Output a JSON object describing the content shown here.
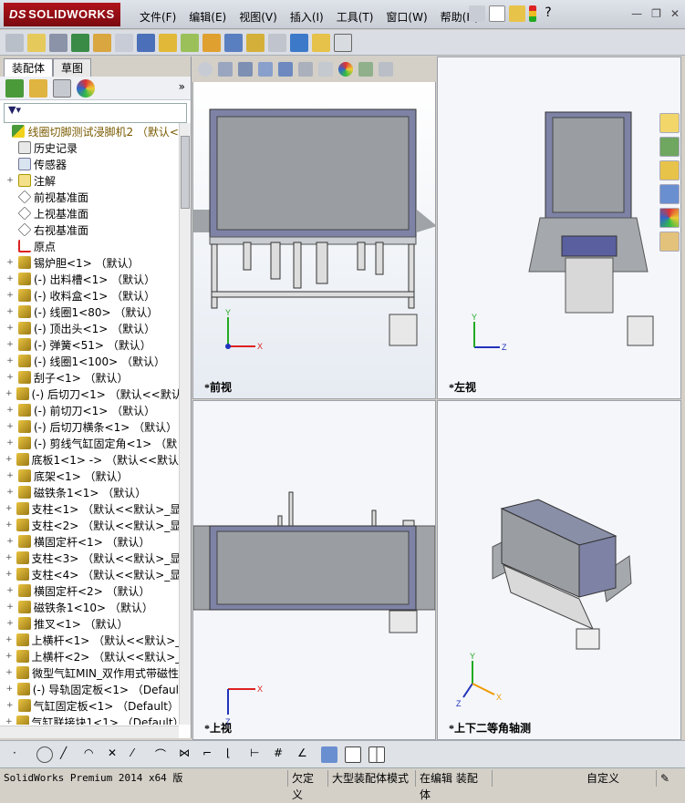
{
  "app": {
    "brand": "SOLIDWORKS",
    "brand_prefix": "DS"
  },
  "menu": [
    "文件(F)",
    "编辑(E)",
    "视图(V)",
    "插入(I)",
    "工具(T)",
    "窗口(W)",
    "帮助(H)"
  ],
  "left_panel": {
    "tabs": [
      "装配体",
      "草图"
    ],
    "tree": [
      {
        "label": "线圈切脚测试浸脚机2 （默认<",
        "icon": "warning",
        "exp": ""
      },
      {
        "label": "历史记录",
        "icon": "history",
        "exp": ""
      },
      {
        "label": "传感器",
        "icon": "sensor",
        "exp": ""
      },
      {
        "label": "注解",
        "icon": "annotation",
        "exp": "+"
      },
      {
        "label": "前视基准面",
        "icon": "plane",
        "exp": ""
      },
      {
        "label": "上视基准面",
        "icon": "plane",
        "exp": ""
      },
      {
        "label": "右视基准面",
        "icon": "plane",
        "exp": ""
      },
      {
        "label": "原点",
        "icon": "origin",
        "exp": ""
      },
      {
        "label": "锡炉胆<1> （默认）",
        "icon": "part",
        "exp": "+"
      },
      {
        "label": "(-) 出料槽<1> （默认）",
        "icon": "part",
        "exp": "+"
      },
      {
        "label": "(-) 收料盒<1> （默认）",
        "icon": "part",
        "exp": "+"
      },
      {
        "label": "(-) 线圈1<80> （默认）",
        "icon": "part",
        "exp": "+"
      },
      {
        "label": "(-) 顶出头<1> （默认）",
        "icon": "part",
        "exp": "+"
      },
      {
        "label": "(-) 弹簧<51> （默认）",
        "icon": "part",
        "exp": "+"
      },
      {
        "label": "(-) 线圈1<100> （默认）",
        "icon": "part",
        "exp": "+"
      },
      {
        "label": "刮子<1> （默认）",
        "icon": "part",
        "exp": "+"
      },
      {
        "label": "(-) 后切刀<1> （默认<<默认",
        "icon": "part",
        "exp": "+"
      },
      {
        "label": "(-) 前切刀<1> （默认）",
        "icon": "part",
        "exp": "+"
      },
      {
        "label": "(-) 后切刀横条<1> （默认）",
        "icon": "part",
        "exp": "+"
      },
      {
        "label": "(-) 剪线气缸固定角<1> （默",
        "icon": "part",
        "exp": "+"
      },
      {
        "label": "底板1<1> -> （默认<<默认>_",
        "icon": "part",
        "exp": "+"
      },
      {
        "label": "底架<1> （默认）",
        "icon": "part",
        "exp": "+"
      },
      {
        "label": "磁铁条1<1> （默认）",
        "icon": "part",
        "exp": "+"
      },
      {
        "label": "支柱<1> （默认<<默认>_显示",
        "icon": "part",
        "exp": "+"
      },
      {
        "label": "支柱<2> （默认<<默认>_显示",
        "icon": "part",
        "exp": "+"
      },
      {
        "label": "横固定杆<1> （默认）",
        "icon": "part",
        "exp": "+"
      },
      {
        "label": "支柱<3> （默认<<默认>_显示",
        "icon": "part",
        "exp": "+"
      },
      {
        "label": "支柱<4> （默认<<默认>_显示",
        "icon": "part",
        "exp": "+"
      },
      {
        "label": "横固定杆<2> （默认）",
        "icon": "part",
        "exp": "+"
      },
      {
        "label": "磁铁条1<10> （默认）",
        "icon": "part",
        "exp": "+"
      },
      {
        "label": "推叉<1> （默认）",
        "icon": "part",
        "exp": "+"
      },
      {
        "label": "上横杆<1> （默认<<默认>_显",
        "icon": "part",
        "exp": "+"
      },
      {
        "label": "上横杆<2> （默认<<默认>_显",
        "icon": "part",
        "exp": "+"
      },
      {
        "label": "微型气缸MIN_双作用式带磁性",
        "icon": "part",
        "exp": "+"
      },
      {
        "label": "(-) 导轨固定板<1> （Defaul",
        "icon": "part",
        "exp": "+"
      },
      {
        "label": "气缸固定板<1> （Default）",
        "icon": "part",
        "exp": "+"
      },
      {
        "label": "气缸联接块1<1> （Default）",
        "icon": "part",
        "exp": "+"
      }
    ]
  },
  "viewports": {
    "front": "*前视",
    "left": "*左视",
    "top": "*上视",
    "iso": "*上下二等角轴测"
  },
  "axes": {
    "x": "X",
    "y": "Y",
    "z": "Z"
  },
  "status_bar": {
    "product": "SolidWorks Premium 2014 x64 版",
    "s1": "欠定义",
    "s2": "大型装配体模式",
    "s3": "在编辑 装配体",
    "s4": "自定义"
  },
  "colors": {
    "titlebar": "#d6dae1",
    "brand_red": "#a3121a",
    "machine_frame": "#8a8fa8",
    "machine_panel": "#9aa0a6"
  }
}
